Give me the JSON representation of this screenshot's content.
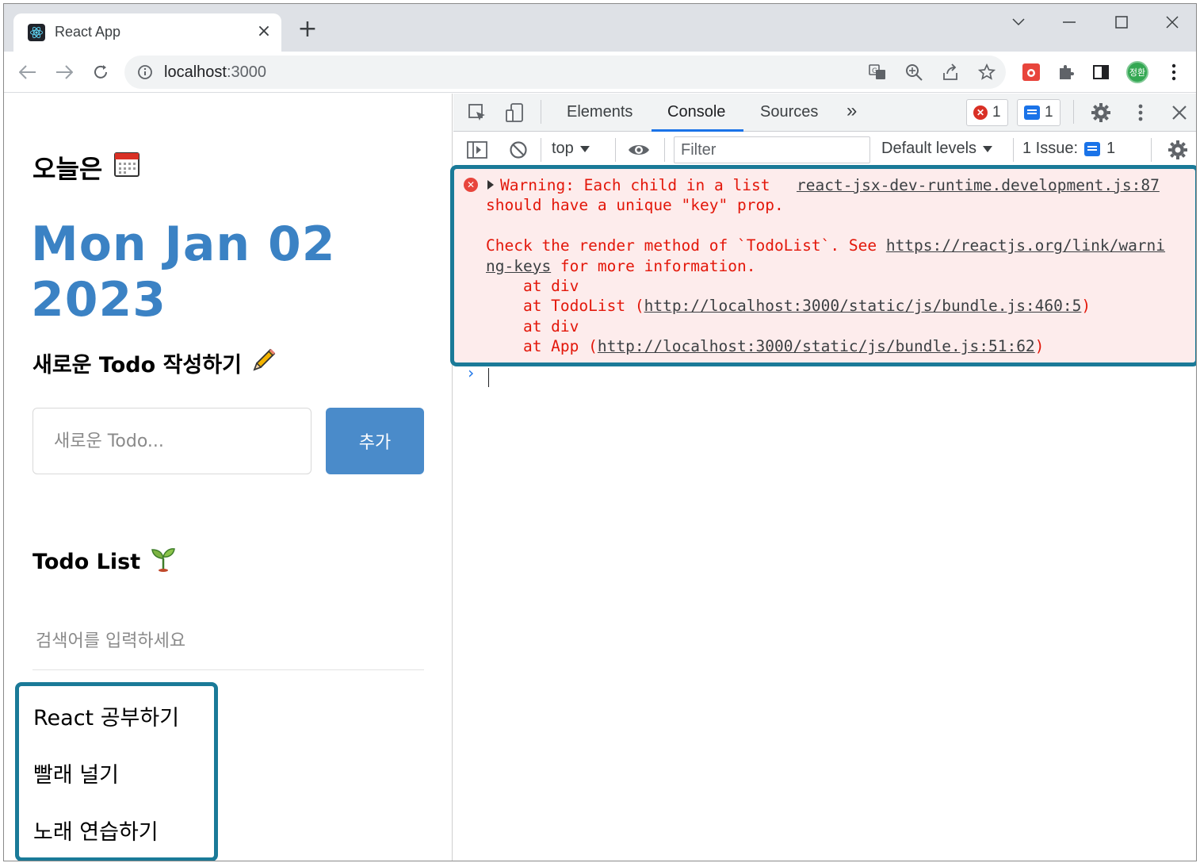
{
  "browser": {
    "tab_title": "React App",
    "tab_close": "×",
    "new_tab": "+",
    "url_host": "localhost",
    "url_port": ":3000",
    "avatar_text": "정환"
  },
  "page": {
    "today_heading": "오늘은",
    "date": "Mon Jan 02 2023",
    "new_todo_heading": "새로운 Todo 작성하기",
    "new_todo_placeholder": "새로운 Todo...",
    "add_button": "추가",
    "todo_list_heading": "Todo List",
    "search_placeholder": "검색어를 입력하세요",
    "todos": [
      "React 공부하기",
      "빨래 널기",
      "노래 연습하기"
    ]
  },
  "devtools": {
    "tabs": [
      "Elements",
      "Console",
      "Sources"
    ],
    "more_tabs": "»",
    "error_count": "1",
    "message_count": "1",
    "context": "top",
    "filter_placeholder": "Filter",
    "levels": "Default levels",
    "issues_label": "1 Issue:",
    "issues_count": "1",
    "error": {
      "line1": "Warning: Each child in a list",
      "source": "react-jsx-dev-runtime.development.js:87",
      "line2": "should have a unique \"key\" prop.",
      "line3_pre": "Check the render method of `TodoList`. See ",
      "line3_link": "https://reactjs.org/link/warni",
      "line4_link": "ng-keys",
      "line4_post": " for more information.",
      "line5": "    at div",
      "line6_pre": "    at TodoList (",
      "line6_link": "http://localhost:3000/static/js/bundle.js:460:5",
      "line6_post": ")",
      "line7": "    at div",
      "line8_pre": "    at App (",
      "line8_link": "http://localhost:3000/static/js/bundle.js:51:62",
      "line8_post": ")"
    },
    "prompt": "›"
  }
}
